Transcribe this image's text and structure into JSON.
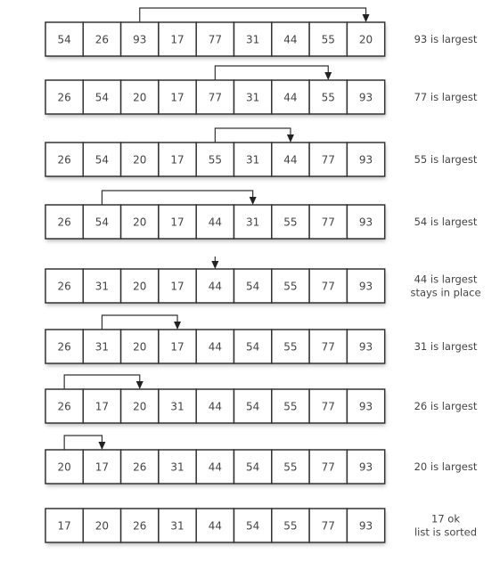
{
  "rows": [
    {
      "values": [
        "54",
        "26",
        "93",
        "17",
        "77",
        "31",
        "44",
        "55",
        "20"
      ],
      "largest_index": 2,
      "swap_index": 8,
      "label": [
        "93 is largest"
      ]
    },
    {
      "values": [
        "26",
        "54",
        "20",
        "17",
        "77",
        "31",
        "44",
        "55",
        "93"
      ],
      "largest_index": 4,
      "swap_index": 7,
      "label": [
        "77 is largest"
      ]
    },
    {
      "values": [
        "26",
        "54",
        "20",
        "17",
        "55",
        "31",
        "44",
        "77",
        "93"
      ],
      "largest_index": 4,
      "swap_index": 6,
      "label": [
        "55 is largest"
      ]
    },
    {
      "values": [
        "26",
        "54",
        "20",
        "17",
        "44",
        "31",
        "55",
        "77",
        "93"
      ],
      "largest_index": 1,
      "swap_index": 5,
      "label": [
        "54 is largest"
      ]
    },
    {
      "values": [
        "26",
        "31",
        "20",
        "17",
        "44",
        "54",
        "55",
        "77",
        "93"
      ],
      "largest_index": 4,
      "swap_index": 4,
      "label": [
        "44 is largest",
        "stays in place"
      ]
    },
    {
      "values": [
        "26",
        "31",
        "20",
        "17",
        "44",
        "54",
        "55",
        "77",
        "93"
      ],
      "largest_index": 1,
      "swap_index": 3,
      "label": [
        "31 is largest"
      ]
    },
    {
      "values": [
        "26",
        "17",
        "20",
        "31",
        "44",
        "54",
        "55",
        "77",
        "93"
      ],
      "largest_index": 0,
      "swap_index": 2,
      "label": [
        "26 is largest"
      ]
    },
    {
      "values": [
        "20",
        "17",
        "26",
        "31",
        "44",
        "54",
        "55",
        "77",
        "93"
      ],
      "largest_index": 0,
      "swap_index": 1,
      "label": [
        "20 is largest"
      ]
    },
    {
      "values": [
        "17",
        "20",
        "26",
        "31",
        "44",
        "54",
        "55",
        "77",
        "93"
      ],
      "largest_index": null,
      "swap_index": null,
      "label": [
        "17 ok",
        "list is sorted"
      ]
    }
  ],
  "colors": {
    "highlight": "#9a9a9a",
    "cell": "#ffffff",
    "border": "#333333"
  }
}
